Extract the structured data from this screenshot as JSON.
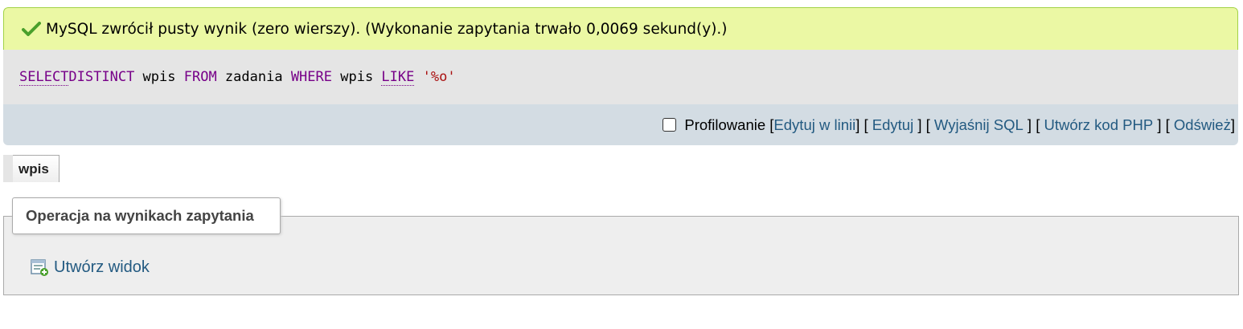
{
  "result": {
    "message": "MySQL zwrócił pusty wynik (zero wierszy). (Wykonanie zapytania trwało 0,0069 sekund(y).)",
    "icon": "success-check-icon",
    "query": {
      "kw_select": "SELECT",
      "kw_distinct": "DISTINCT",
      "col1": " wpis ",
      "kw_from": "FROM",
      "table": " zadania ",
      "kw_where": "WHERE",
      "col2": " wpis ",
      "kw_like": "LIKE",
      "pattern": " '%o'"
    }
  },
  "tools": {
    "profiling_label": "Profilowanie",
    "profiling_checked": false,
    "inline_edit": "Edytuj w linii",
    "edit": "Edytuj",
    "explain": "Wyjaśnij SQL",
    "php": "Utwórz kod PHP",
    "refresh": "Odśwież"
  },
  "table": {
    "columns": [
      "wpis"
    ]
  },
  "operations": {
    "legend": "Operacja na wynikach zapytania",
    "create_view": "Utwórz widok",
    "create_view_icon": "view-add-icon"
  },
  "colors": {
    "success_bg": "#ebf8a4",
    "query_bg": "#e5e5e5",
    "tools_bg": "#d3dce3",
    "link": "#235a81",
    "keyword": "#770088",
    "string": "#aa1111"
  }
}
